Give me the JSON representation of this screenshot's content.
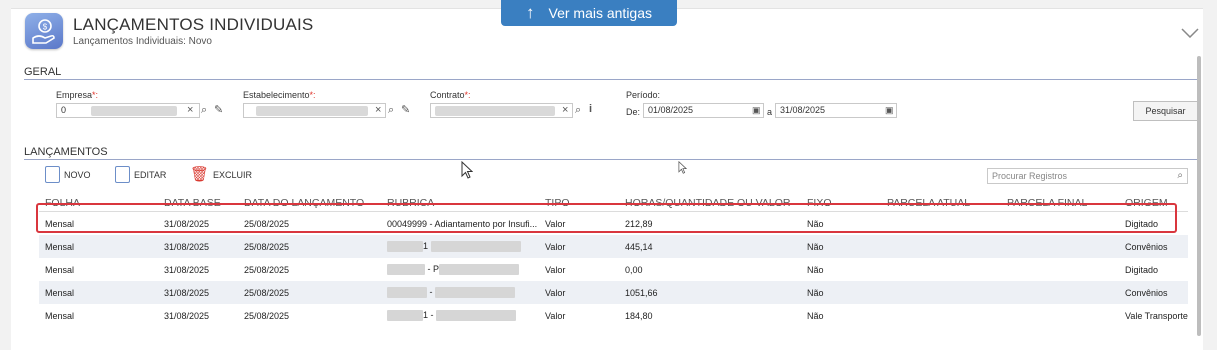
{
  "top_button": {
    "label": "Ver mais antigas",
    "icon": "arrow-up-icon"
  },
  "header": {
    "title": "LANÇAMENTOS INDIVIDUAIS",
    "subtitle": "Lançamentos Individuais: Novo",
    "icon": "hand-money-icon"
  },
  "geral": {
    "section_title": "GERAL",
    "empresa_label": "Empresa",
    "empresa_value": "0",
    "estabelecimento_label": "Estabelecimento",
    "contrato_label": "Contrato",
    "periodo_label": "Período:",
    "de_label": "De:",
    "de_value": "01/08/2025",
    "a_label": "a",
    "ate_value": "31/08/2025",
    "required_mark": "*:",
    "search_button": "Pesquisar"
  },
  "lancamentos": {
    "section_title": "LANÇAMENTOS",
    "toolbar": {
      "novo": "NOVO",
      "editar": "EDITAR",
      "excluir": "EXCLUIR"
    },
    "search_placeholder": "Procurar Registros",
    "columns": [
      "FOLHA",
      "DATA BASE",
      "DATA DO LANÇAMENTO",
      "RUBRICA",
      "TIPO",
      "HORAS/QUANTIDADE OU VALOR",
      "FIXO",
      "PARCELA ATUAL",
      "PARCELA FINAL",
      "ORIGEM"
    ],
    "rows": [
      {
        "folha": "Mensal",
        "data_base": "31/08/2025",
        "data_lanc": "25/08/2025",
        "rubrica": "00049999 - Adiantamento por Insufi...",
        "tipo": "Valor",
        "valor": "212,89",
        "fixo": "Não",
        "origem": "Digitado"
      },
      {
        "folha": "Mensal",
        "data_base": "31/08/2025",
        "data_lanc": "25/08/2025",
        "rubrica": "1",
        "tipo": "Valor",
        "valor": "445,14",
        "fixo": "Não",
        "origem": "Convênios"
      },
      {
        "folha": "Mensal",
        "data_base": "31/08/2025",
        "data_lanc": "25/08/2025",
        "rubrica": "- P",
        "tipo": "Valor",
        "valor": "0,00",
        "fixo": "Não",
        "origem": "Digitado"
      },
      {
        "folha": "Mensal",
        "data_base": "31/08/2025",
        "data_lanc": "25/08/2025",
        "rubrica": "-",
        "tipo": "Valor",
        "valor": "1051,66",
        "fixo": "Não",
        "origem": "Convênios"
      },
      {
        "folha": "Mensal",
        "data_base": "31/08/2025",
        "data_lanc": "25/08/2025",
        "rubrica": "1 -",
        "tipo": "Valor",
        "valor": "184,80",
        "fixo": "Não",
        "origem": "Vale Transporte"
      }
    ]
  },
  "colors": {
    "accent": "#3a7fc1",
    "highlight": "#d9363e",
    "row_alt": "#edf0f5"
  }
}
